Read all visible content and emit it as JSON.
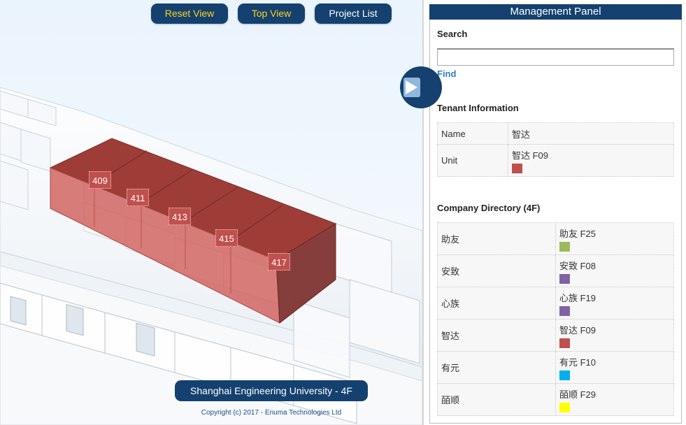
{
  "toolbar": {
    "reset_view": "Reset View",
    "top_view": "Top View",
    "project_list": "Project List"
  },
  "units": [
    {
      "label": "409"
    },
    {
      "label": "411"
    },
    {
      "label": "413"
    },
    {
      "label": "415"
    },
    {
      "label": "417"
    }
  ],
  "viewport": {
    "project_caption": "Shanghai Engineering University - 4F",
    "copyright": "Copyright (c) 2017 - Enuma Technologies Ltd"
  },
  "panel": {
    "title": "Management Panel",
    "search": {
      "title": "Search",
      "value": "",
      "placeholder": "",
      "find_label": "Find"
    },
    "tenant": {
      "title": "Tenant Information",
      "name_label": "Name",
      "name_value": "智达",
      "unit_label": "Unit",
      "unit_value": "智达 F09",
      "unit_color": "#c0504d"
    },
    "directory": {
      "title": "Company Directory (4F)",
      "rows": [
        {
          "name": "助友",
          "unit": "助友 F25",
          "color": "#9bbb59"
        },
        {
          "name": "安致",
          "unit": "安致 F08",
          "color": "#8064a2"
        },
        {
          "name": "心族",
          "unit": "心族 F19",
          "color": "#8064a2"
        },
        {
          "name": "智达",
          "unit": "智达 F09",
          "color": "#c0504d"
        },
        {
          "name": "有元",
          "unit": "有元 F10",
          "color": "#00b0f0"
        },
        {
          "name": "皕顺",
          "unit": "皕顺 F29",
          "color": "#ffff00"
        }
      ]
    }
  },
  "colors": {
    "brand_navy": "#14416f",
    "accent_yellow": "#ffd21a",
    "highlight_red": "#a6403c",
    "link_blue": "#2a7fc1"
  }
}
